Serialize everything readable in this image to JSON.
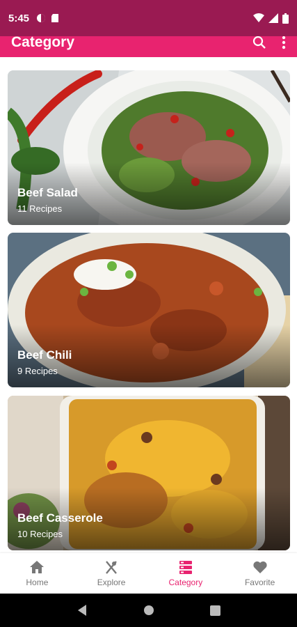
{
  "status_bar": {
    "time": "5:45"
  },
  "app_bar": {
    "title": "Category",
    "actions": [
      "search-icon",
      "more-vert-icon"
    ]
  },
  "categories": [
    {
      "name": "Beef Salad",
      "count": "11 Recipes"
    },
    {
      "name": "Beef Chili",
      "count": "9 Recipes"
    },
    {
      "name": "Beef Casserole",
      "count": "10 Recipes"
    }
  ],
  "bottom_nav": {
    "items": [
      {
        "label": "Home",
        "icon": "home-icon"
      },
      {
        "label": "Explore",
        "icon": "utensils-icon"
      },
      {
        "label": "Category",
        "icon": "category-icon",
        "active": true
      },
      {
        "label": "Favorite",
        "icon": "heart-icon"
      }
    ]
  },
  "colors": {
    "status_bar": "#9a1a52",
    "app_bar": "#e8236f",
    "accent": "#e8236f",
    "inactive": "#777777"
  }
}
